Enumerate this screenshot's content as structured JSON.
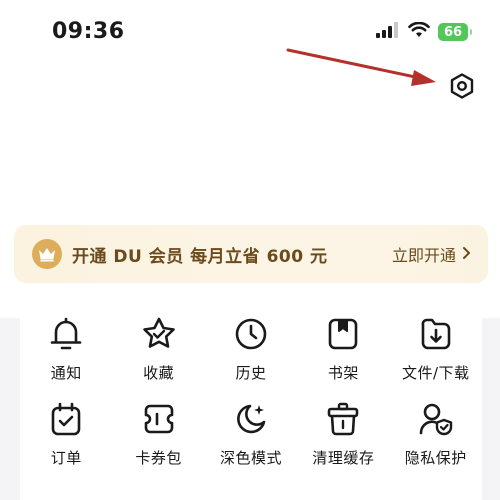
{
  "status_bar": {
    "time": "09:36",
    "battery": "66"
  },
  "header": {
    "settings_icon": "hexagon-gear-icon"
  },
  "vip_banner": {
    "crown_icon": "crown-icon",
    "text": "开通 DU 会员 每月立省 600 元",
    "action_label": "立即开通",
    "accent": "#dcae5b",
    "text_color": "#6b4a1c"
  },
  "menu": {
    "items": [
      {
        "label": "通知",
        "icon": "bell-icon"
      },
      {
        "label": "收藏",
        "icon": "star-icon"
      },
      {
        "label": "历史",
        "icon": "clock-icon"
      },
      {
        "label": "书架",
        "icon": "bookmark-icon"
      },
      {
        "label": "文件/下载",
        "icon": "download-icon"
      },
      {
        "label": "订单",
        "icon": "order-icon"
      },
      {
        "label": "卡券包",
        "icon": "ticket-icon"
      },
      {
        "label": "深色模式",
        "icon": "moon-icon"
      },
      {
        "label": "清理缓存",
        "icon": "trash-icon"
      },
      {
        "label": "隐私保护",
        "icon": "privacy-icon"
      }
    ]
  },
  "colors": {
    "annotation_arrow": "#b5302a",
    "battery": "#55c65a",
    "background_gray": "#f4f4f6"
  }
}
